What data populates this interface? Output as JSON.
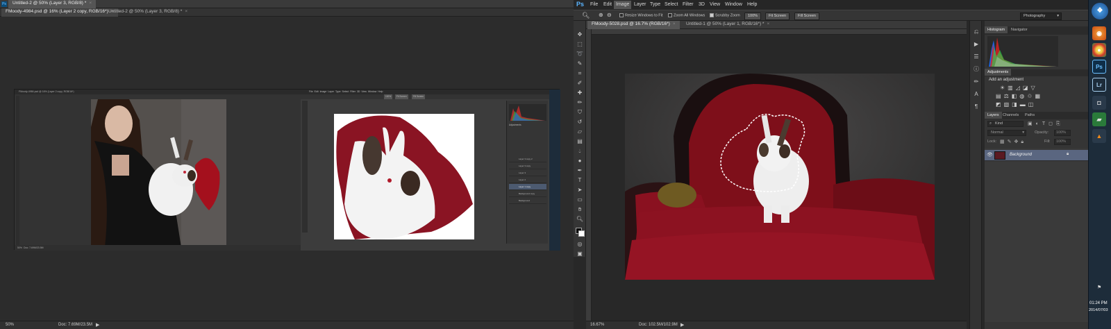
{
  "left_app": {
    "tabs": [
      {
        "label": "Untitled-2 @ 50% (Layer 3, RGB/8) *",
        "active": true
      },
      {
        "label": "FMoody-4984.psd @ 16% (Layer 2 copy, RGB/16*)",
        "active": false
      },
      {
        "label": "Untitled-2 @ 50% (Layer 3, RGB/8) *",
        "active": false
      }
    ],
    "status_zoom": "50%",
    "status_doc": "Doc: 7.69M/23.5M"
  },
  "right_app": {
    "logo": "Ps",
    "menu": [
      "File",
      "Edit",
      "Image",
      "Layer",
      "Type",
      "Select",
      "Filter",
      "3D",
      "View",
      "Window",
      "Help"
    ],
    "active_menu": "Image",
    "options": {
      "resize_windows": "Resize Windows to Fit",
      "zoom_all": "Zoom All Windows",
      "scrubby_zoom": "Scrubby Zoom",
      "btn_100": "100%",
      "btn_fit": "Fit Screen",
      "btn_fill": "Fill Screen"
    },
    "workspace": "Photography",
    "tabs": [
      {
        "label": "FMoody-5028.psd @ 16.7% (RGB/16*)",
        "active": true
      },
      {
        "label": "Untitled-1 @ 50% (Layer 1, RGB/16*) *",
        "active": false
      }
    ],
    "status_zoom": "16.67%",
    "status_doc": "Doc: 102.5M/102.9M",
    "panels": {
      "histogram_tab": "Histogram",
      "navigator_tab": "Navigator",
      "adjustments_tab": "Adjustments",
      "adjustments_title": "Add an adjustment",
      "layers_tab": "Layers",
      "channels_tab": "Channels",
      "paths_tab": "Paths",
      "kind_label": "Kind",
      "blend_mode": "Normal",
      "opacity_label": "Opacity:",
      "opacity_value": "100%",
      "lock_label": "Lock:",
      "fill_label": "Fill:",
      "fill_value": "100%",
      "layer_name": "Background"
    }
  },
  "embedded_screenshot": {
    "title": "FMoody-4984.psd @ 16% (Layer 2 copy, RGB/16*)",
    "menu": [
      "File",
      "Edit",
      "Image",
      "Layer",
      "Type",
      "Select",
      "Filter",
      "3D",
      "View",
      "Window",
      "Help"
    ],
    "buttons": [
      "100%",
      "Fit Screen",
      "Fill Screen"
    ],
    "status_zoom": "50%",
    "status_doc": "Doc: 7.69M/23.5M",
    "adjustments_label": "Adjustments",
    "layers": [
      "Layer 3 copy 2",
      "Layer 3 copy",
      "Layer 3",
      "Layer 2",
      "Layer 1 copy",
      "Background copy",
      "Background"
    ]
  },
  "taskbar": {
    "time": "01:24 PM",
    "date": "2014/07/03",
    "icons": [
      "windows-start",
      "firefox",
      "chrome",
      "photoshop",
      "lightroom",
      "camera",
      "folder-green",
      "vlc"
    ]
  }
}
